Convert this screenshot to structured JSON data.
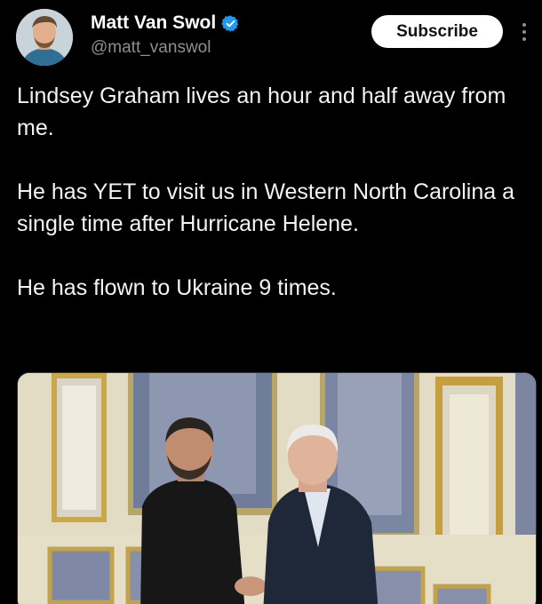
{
  "author": {
    "name": "Matt Van Swol",
    "handle": "@matt_vanswol",
    "verified": true,
    "avatar_icon": "profile-photo"
  },
  "header": {
    "subscribe_label": "Subscribe",
    "more_icon": "more-vertical-icon"
  },
  "tweet": {
    "paragraphs": [
      "Lindsey Graham lives an hour and half away from me.",
      "He has YET to visit us in Western North Carolina a single time after Hurricane Helene.",
      "He has flown to Ukraine 9 times."
    ]
  },
  "media": {
    "type": "photo"
  },
  "colors": {
    "background": "#000000",
    "text": "#f2f3f4",
    "secondary": "#8b8f94",
    "verified": "#1d9bf0",
    "button_bg": "#ffffff",
    "button_text": "#0f1419"
  }
}
